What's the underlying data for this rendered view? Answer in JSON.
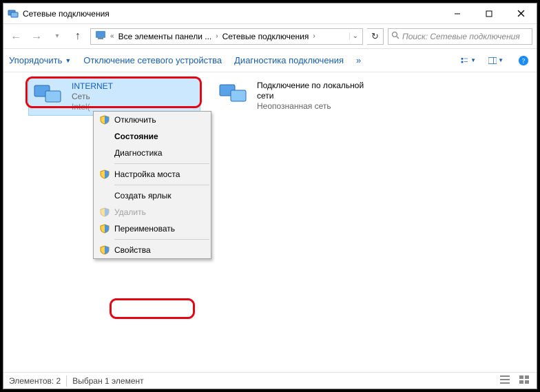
{
  "title": "Сетевые подключения",
  "breadcrumb": {
    "seg1": "Все элементы панели ...",
    "seg2": "Сетевые подключения"
  },
  "search": {
    "placeholder": "Поиск: Сетевые подключения"
  },
  "toolbar": {
    "organize": "Упорядочить",
    "disable": "Отключение сетевого устройства",
    "diagnose": "Диагностика подключения",
    "overflow": "»"
  },
  "connections": [
    {
      "name": "INTERNET",
      "line2": "Сеть",
      "line3": "Intel(",
      "selected": true
    },
    {
      "name": "Подключение по локальной сети",
      "line2": "Неопознанная сеть",
      "line3": "",
      "selected": false
    }
  ],
  "context_menu": {
    "disable": "Отключить",
    "state": "Состояние",
    "diag": "Диагностика",
    "bridge": "Настройка моста",
    "shortcut": "Создать ярлык",
    "delete": "Удалить",
    "rename": "Переименовать",
    "properties": "Свойства"
  },
  "status": {
    "elements": "Элементов: 2",
    "selected": "Выбран 1 элемент"
  }
}
